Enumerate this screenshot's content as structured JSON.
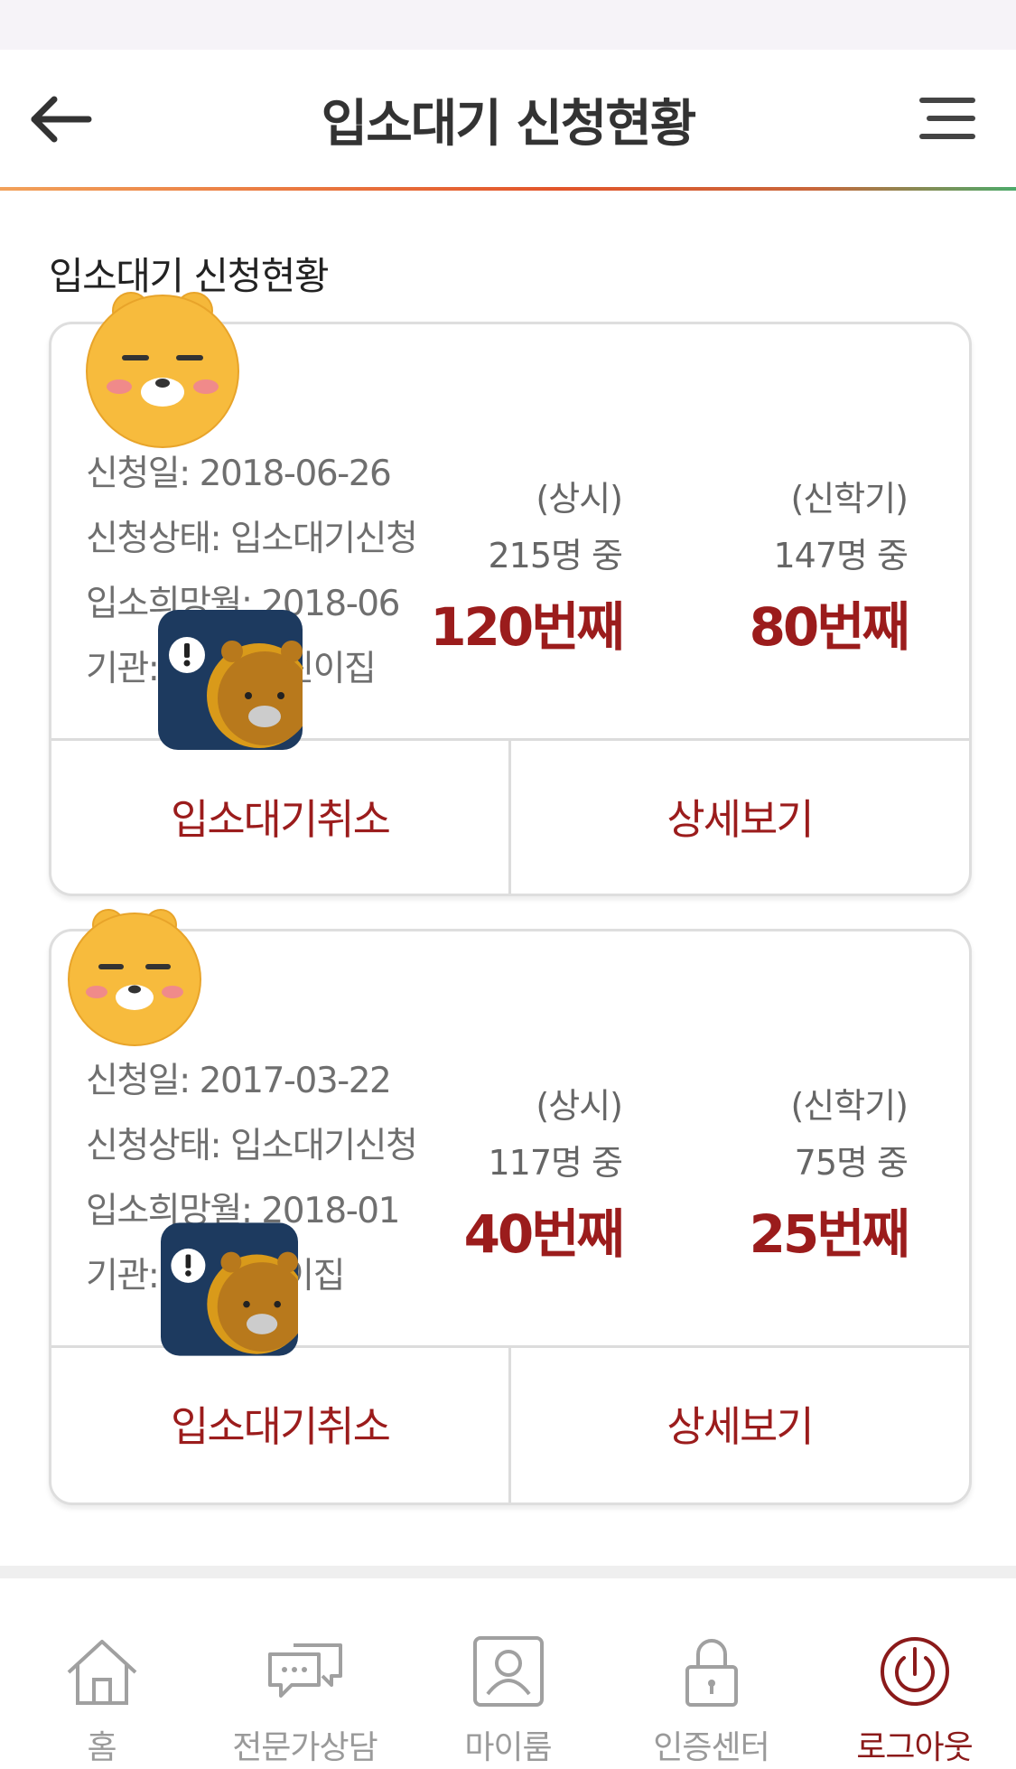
{
  "header": {
    "title": "입소대기 신청현황",
    "accent_colors": [
      "#f2a15a",
      "#e2552a",
      "#4caa6a"
    ]
  },
  "section_title": "입소대기 신청현황",
  "applications": [
    {
      "apply_date": "신청일: 2018-06-26",
      "status": "신청상태: 입소대기신청",
      "desired_month": "입소희망월: 2018-06",
      "institution": "기관: ",
      "institution_tail": "린이집",
      "regular": {
        "type": "(상시)",
        "total": "215명 중",
        "rank": "120번째"
      },
      "semester": {
        "type": "(신학기)",
        "total": "147명 중",
        "rank": "80번째"
      },
      "cancel_label": "입소대기취소",
      "detail_label": "상세보기"
    },
    {
      "apply_date": "신청일: 2017-03-22",
      "status": "신청상태: 입소대기신청",
      "desired_month": "입소희망월: 2018-01",
      "institution": "기관: ",
      "institution_tail": "이집",
      "regular": {
        "type": "(상시)",
        "total": "117명 중",
        "rank": "40번째"
      },
      "semester": {
        "type": "(신학기)",
        "total": "75명 중",
        "rank": "25번째"
      },
      "cancel_label": "입소대기취소",
      "detail_label": "상세보기"
    }
  ],
  "bottom_nav": [
    {
      "label": "홈",
      "icon": "home-icon",
      "active": false
    },
    {
      "label": "전문가상담",
      "icon": "chat-icon",
      "active": false
    },
    {
      "label": "마이룸",
      "icon": "user-icon",
      "active": false
    },
    {
      "label": "인증센터",
      "icon": "lock-icon",
      "active": false
    },
    {
      "label": "로그아웃",
      "icon": "power-icon",
      "active": true
    }
  ],
  "colors": {
    "rank": "#9b1c1c",
    "active_nav": "#8b1a1a"
  }
}
